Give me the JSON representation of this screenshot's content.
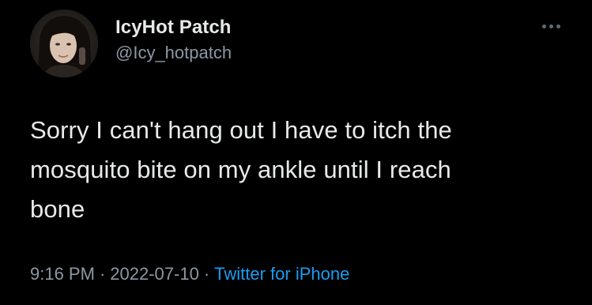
{
  "user": {
    "display_name": "IcyHot Patch",
    "handle": "@Icy_hotpatch"
  },
  "tweet": {
    "text_lines": [
      "Sorry I can't hang out I have to itch the",
      "mosquito bite on my ankle until I reach",
      "bone"
    ],
    "time": "9:16 PM",
    "date": "2022-07-10",
    "separator": "·",
    "source": "Twitter for iPhone"
  },
  "icons": {
    "more": "more-horizontal-icon",
    "avatar": "profile-photo"
  },
  "colors": {
    "background": "#000000",
    "text": "#e7e9ea",
    "muted": "#8b98a5",
    "link": "#1d9bf0"
  }
}
